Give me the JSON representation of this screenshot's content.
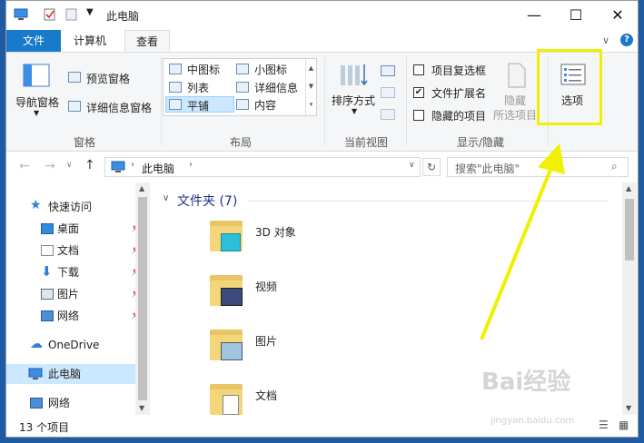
{
  "window": {
    "title": "此电脑"
  },
  "titlebar": {
    "minimize": "—",
    "maximize": "☐",
    "close": "✕"
  },
  "tabs": [
    {
      "label": "文件"
    },
    {
      "label": "计算机"
    },
    {
      "label": "查看"
    }
  ],
  "help": "?",
  "ribbon": {
    "panes": {
      "nav_pane": "导航窗格",
      "preview_pane": "预览窗格",
      "details_pane": "详细信息窗格",
      "group": "窗格"
    },
    "layout": {
      "items": [
        "中图标",
        "小图标",
        "列表",
        "详细信息",
        "平铺",
        "内容"
      ],
      "group": "布局"
    },
    "current_view": {
      "sort_by": "排序方式",
      "group": "当前视图"
    },
    "show_hide": {
      "item_checkboxes": "项目复选框",
      "file_extensions": "文件扩展名",
      "hidden_items": "隐藏的项目",
      "hide_selected_line1": "隐藏",
      "hide_selected_line2": "所选项目",
      "options": "选项",
      "group": "显示/隐藏",
      "file_extensions_checked": true,
      "item_checkboxes_checked": false,
      "hidden_items_checked": false
    }
  },
  "address": {
    "path": "此电脑",
    "search_placeholder": "搜索\"此电脑\""
  },
  "nav": {
    "quick_access": "快速访问",
    "items": [
      {
        "label": "桌面"
      },
      {
        "label": "文档"
      },
      {
        "label": "下载"
      },
      {
        "label": "图片"
      },
      {
        "label": "网络"
      }
    ],
    "onedrive": "OneDrive",
    "this_pc": "此电脑",
    "network": "网络"
  },
  "content": {
    "group_header": "文件夹 (7)",
    "folders": [
      {
        "name": "3D 对象"
      },
      {
        "name": "视频"
      },
      {
        "name": "图片"
      },
      {
        "name": "文档"
      }
    ]
  },
  "status": {
    "count": "13 个项目"
  },
  "watermark": {
    "text": "Bai经验",
    "sub": "jingyan.baidu.com"
  },
  "colors": {
    "file_tab": "#1979ca",
    "highlight": "#f0f000",
    "selected_nav": "#cce8ff"
  }
}
